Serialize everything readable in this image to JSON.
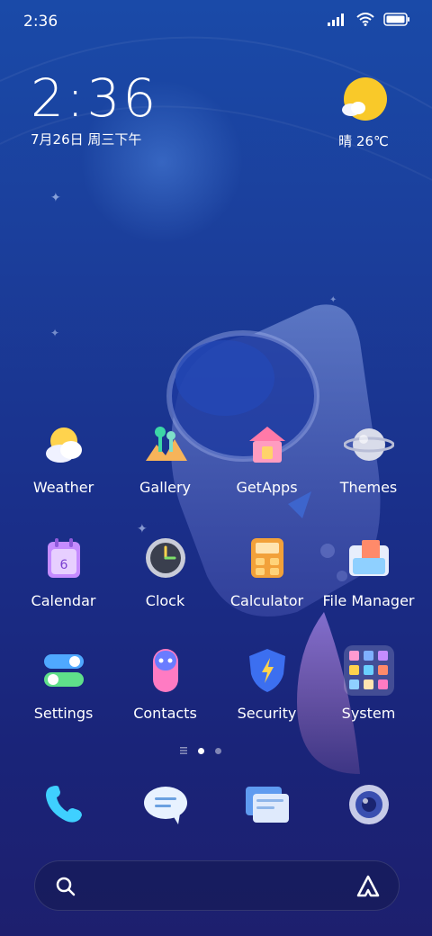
{
  "status_bar": {
    "time": "2:36",
    "icons": [
      "signal-icon",
      "wifi-icon",
      "battery-icon"
    ]
  },
  "clock_widget": {
    "time": "2:36",
    "date": "7月26日 周三下午"
  },
  "weather_widget": {
    "icon": "sun-cloud-icon",
    "text": "晴 26℃"
  },
  "apps": {
    "row1": [
      {
        "label": "Weather",
        "icon": "weather-icon"
      },
      {
        "label": "Gallery",
        "icon": "gallery-icon"
      },
      {
        "label": "GetApps",
        "icon": "getapps-icon"
      },
      {
        "label": "Themes",
        "icon": "themes-icon"
      }
    ],
    "row2": [
      {
        "label": "Calendar",
        "icon": "calendar-icon"
      },
      {
        "label": "Clock",
        "icon": "clock-icon"
      },
      {
        "label": "Calculator",
        "icon": "calculator-icon"
      },
      {
        "label": "File Manager",
        "icon": "file-manager-icon"
      }
    ],
    "row3": [
      {
        "label": "Settings",
        "icon": "settings-icon"
      },
      {
        "label": "Contacts",
        "icon": "contacts-icon"
      },
      {
        "label": "Security",
        "icon": "security-icon"
      },
      {
        "label": "System",
        "icon": "system-folder-icon"
      }
    ]
  },
  "dock": [
    "phone-icon",
    "messages-icon",
    "browser-icon",
    "camera-icon"
  ],
  "page_indicator": {
    "pages": 2,
    "current": 1
  },
  "search": {
    "left_icon": "search-icon",
    "right_icon": "assistant-icon"
  },
  "calendar_day": "6"
}
